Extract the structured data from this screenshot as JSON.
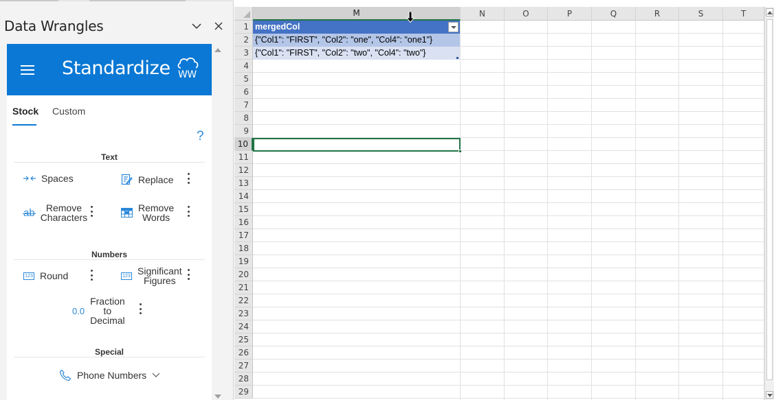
{
  "pane": {
    "title": "Data Wrangles",
    "collapse_icon": "chevron-down-icon",
    "close_icon": "close-icon",
    "addin": {
      "title": "Standardize",
      "logo_text": "WW",
      "header_color": "#0a78d4"
    },
    "tabs": [
      {
        "label": "Stock",
        "active": true
      },
      {
        "label": "Custom",
        "active": false
      }
    ],
    "help_label": "?",
    "sections": {
      "text": {
        "title": "Text",
        "items": [
          {
            "label": "Spaces",
            "icon": "arrows-inward-icon"
          },
          {
            "label": "Replace",
            "icon": "edit-document-icon"
          },
          {
            "label_line1": "Remove",
            "label_line2": "Characters",
            "icon": "strikethrough-ab-icon",
            "icon_text": "ab"
          },
          {
            "label_line1": "Remove",
            "label_line2": "Words",
            "icon": "table-remove-icon"
          }
        ]
      },
      "numbers": {
        "title": "Numbers",
        "items": [
          {
            "label": "Round",
            "icon": "number-123-icon",
            "icon_text": "123"
          },
          {
            "label_line1": "Significant",
            "label_line2": "Figures",
            "icon": "number-123-icon",
            "icon_text": "123"
          },
          {
            "label_line1": "Fraction",
            "label_line2": "to",
            "label_line3": "Decimal",
            "icon": "decimal-icon",
            "icon_text": "0.0"
          }
        ]
      },
      "special": {
        "title": "Special",
        "items": [
          {
            "label": "Phone Numbers",
            "icon": "phone-icon"
          }
        ]
      }
    }
  },
  "sheet": {
    "columns": [
      "M",
      "N",
      "O",
      "P",
      "Q",
      "R",
      "S",
      "T"
    ],
    "selected_column": "M",
    "rows": [
      "1",
      "2",
      "3",
      "4",
      "5",
      "6",
      "7",
      "8",
      "9",
      "10",
      "11",
      "12",
      "13",
      "14",
      "15",
      "16",
      "17",
      "18",
      "19",
      "20",
      "21",
      "22",
      "23",
      "24",
      "25",
      "26",
      "27",
      "28",
      "29"
    ],
    "selected_row": "10",
    "header_cell": "mergedCol",
    "cells": [
      "{\"Col1\": \"FIRST\", \"Col2\": \"one\", \"Col4\": \"one1\"}",
      "{\"Col1\": \"FIRST\", \"Col2\": \"two\", \"Col4\": \"two\"}"
    ],
    "table_header_color": "#4472c4",
    "selection_color": "#217346"
  }
}
